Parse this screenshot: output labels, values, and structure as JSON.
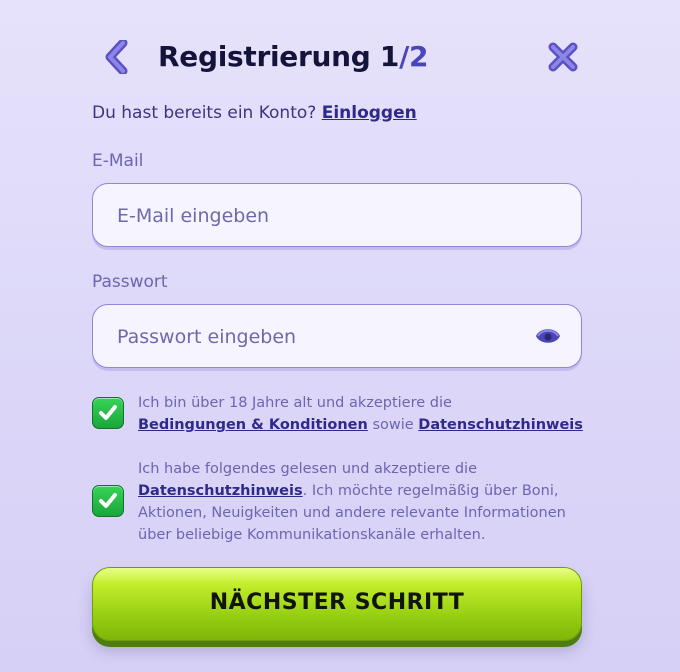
{
  "header": {
    "title": "Registrierung 1",
    "title_separator": "/",
    "title_total": "2"
  },
  "login": {
    "prompt": "Du hast bereits ein Konto?",
    "link": "Einloggen"
  },
  "email": {
    "label": "E-Mail",
    "placeholder": "E-Mail eingeben",
    "value": ""
  },
  "password": {
    "label": "Passwort",
    "placeholder": "Passwort eingeben",
    "value": "",
    "toggle_icon": "eye-icon"
  },
  "consents": [
    {
      "checked": true,
      "text_before": "Ich bin über 18 Jahre alt und akzeptiere die",
      "link_1": "Bedingungen & Konditionen",
      "text_middle": "sowie",
      "link_2": "Datenschutzhinweis"
    },
    {
      "checked": true,
      "text_before": "Ich habe folgendes gelesen und akzeptiere die",
      "link_1": "Datenschutzhinweis",
      "text_after": ". Ich möchte regelmäßig über Boni, Aktionen, Neuigkeiten und andere relevante Informationen über beliebige Kommunikationskanäle erhalten."
    }
  ],
  "cta": {
    "label": "NÄCHSTER SCHRITT"
  },
  "colors": {
    "background": "#dcd7f8",
    "accent": "#4b45b8",
    "checkbox_green": "#22b844",
    "cta_green": "#a3d916"
  }
}
